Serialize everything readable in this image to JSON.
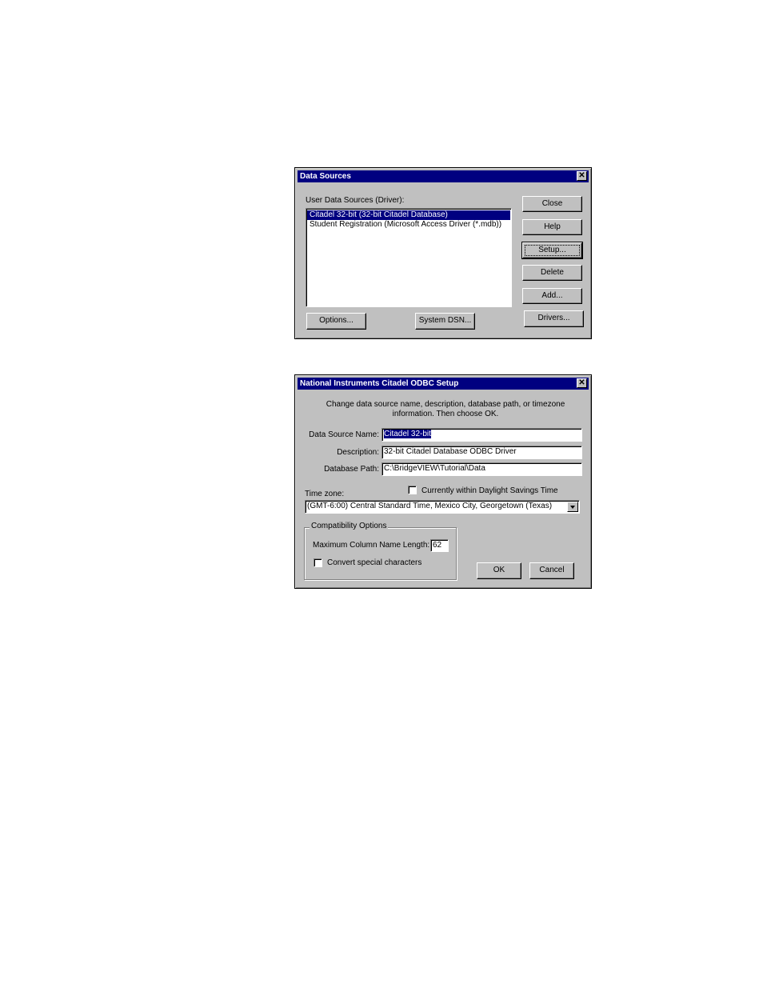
{
  "data_sources": {
    "title": "Data Sources",
    "list_label": "User Data Sources (Driver):",
    "items": [
      {
        "label": "Citadel 32-bit (32-bit Citadel Database)",
        "selected": true
      },
      {
        "label": "Student Registration (Microsoft Access Driver (*.mdb))",
        "selected": false
      }
    ],
    "buttons": {
      "close": "Close",
      "help": "Help",
      "setup": "Setup...",
      "delete": "Delete",
      "add": "Add...",
      "options": "Options...",
      "system_dsn": "System DSN...",
      "drivers": "Drivers..."
    }
  },
  "odbc_setup": {
    "title": "National Instruments Citadel ODBC Setup",
    "instructions": "Change data source name, description, database path, or timezone information.  Then choose OK.",
    "dsn_label": "Data Source Name:",
    "dsn_value": "Citadel 32-bit",
    "desc_label": "Description:",
    "desc_value": "32-bit Citadel Database ODBC Driver",
    "path_label": "Database Path:",
    "path_value": "C:\\BridgeVIEW\\Tutorial\\Data",
    "timezone_label": "Time zone:",
    "dst_label": "Currently within Daylight Savings Time",
    "dst_checked": false,
    "timezone_value": "(GMT-6:00) Central Standard Time, Mexico City, Georgetown (Texas)",
    "compat_group": "Compatibility Options",
    "max_col_label": "Maximum Column Name Length:",
    "max_col_value": "62",
    "convert_label": "Convert special characters",
    "convert_checked": false,
    "ok": "OK",
    "cancel": "Cancel"
  },
  "colors": {
    "title_bar": "#000080",
    "dialog_bg": "#c0c0c0",
    "selection": "#000080"
  }
}
